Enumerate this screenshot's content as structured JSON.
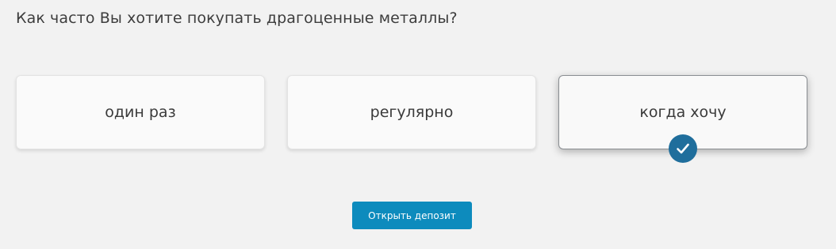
{
  "question": "Как часто Вы хотите покупать драгоценные металлы?",
  "options": [
    {
      "label": "один раз",
      "selected": false
    },
    {
      "label": "регулярно",
      "selected": false
    },
    {
      "label": "когда хочу",
      "selected": true
    }
  ],
  "selected_icon": "check-icon",
  "cta": {
    "label": "Открыть депозит"
  },
  "colors": {
    "background": "#f2f2f2",
    "accent": "#0d8bbd",
    "check_badge": "#1f6e9c"
  }
}
